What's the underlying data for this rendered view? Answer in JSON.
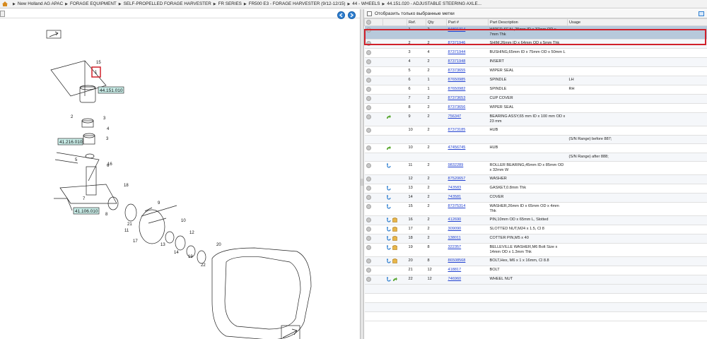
{
  "breadcrumb": [
    "New Holland AG APAC",
    "FORAGE EQUIPMENT",
    "SELF-PROPELLED FORAGE HARVESTER",
    "FR SERIES",
    "FR500 E3 - FORAGE HARVESTER (9/12-12/15)",
    "44 - WHEELS",
    "44.151.020 - ADJUSTABLE STEERING AXLE..."
  ],
  "filter_label": "Отобразить только выбранные метки",
  "columns": {
    "ref": "Ref.",
    "qty": "Qty",
    "part": "Part #",
    "desc": "Part Description",
    "usage": "Usage"
  },
  "rows": [
    {
      "ref": "1",
      "qty": "2",
      "part": "84801314",
      "desc": "WIPER SEAL,25mm ID x 37mm OD x 7mm Thk",
      "usage": "",
      "icons": []
    },
    {
      "ref": "2",
      "qty": "2",
      "part": "87371946",
      "desc": "SHIM,26mm ID x 64mm OD x 5mm Thk",
      "usage": "",
      "icons": []
    },
    {
      "ref": "3",
      "qty": "4",
      "part": "87371944",
      "desc": "BUSHING,65mm ID x 75mm OD x 50mm L",
      "usage": "",
      "icons": []
    },
    {
      "ref": "4",
      "qty": "2",
      "part": "87371948",
      "desc": "INSERT",
      "usage": "",
      "icons": []
    },
    {
      "ref": "5",
      "qty": "2",
      "part": "87373655",
      "desc": "WIPER SEAL",
      "usage": "",
      "icons": []
    },
    {
      "ref": "6",
      "qty": "1",
      "part": "87650985",
      "desc": "SPINDLE",
      "usage": "LH",
      "icons": []
    },
    {
      "ref": "6",
      "qty": "1",
      "part": "87650982",
      "desc": "SPINDLE",
      "usage": "RH",
      "icons": []
    },
    {
      "ref": "7",
      "qty": "2",
      "part": "87373653",
      "desc": "CUP COVER",
      "usage": "",
      "icons": []
    },
    {
      "ref": "8",
      "qty": "2",
      "part": "87373656",
      "desc": "WIPER SEAL",
      "usage": "",
      "icons": []
    },
    {
      "ref": "9",
      "qty": "2",
      "part": "756347",
      "desc": "BEARING ASSY,65 mm ID x 100 mm OD x 23 mm",
      "usage": "",
      "icons": [
        "green"
      ]
    },
    {
      "ref": "10",
      "qty": "2",
      "part": "87373185",
      "desc": "HUB",
      "usage": "",
      "icons": []
    },
    {
      "ref": "",
      "qty": "",
      "part": "",
      "desc": "",
      "usage": "(S/N Range) before 887;",
      "icons": []
    },
    {
      "ref": "10",
      "qty": "2",
      "part": "47456745",
      "desc": "HUB",
      "usage": "",
      "icons": [
        "green"
      ]
    },
    {
      "ref": "",
      "qty": "",
      "part": "",
      "desc": "",
      "usage": "(S/N Range) after 888;",
      "icons": []
    },
    {
      "ref": "11",
      "qty": "2",
      "part": "9832289",
      "desc": "ROLLER BEARING,45mm ID x 85mm OD x 32mm W",
      "usage": "",
      "icons": [
        "blue"
      ]
    },
    {
      "ref": "12",
      "qty": "2",
      "part": "87520657",
      "desc": "WASHER",
      "usage": "",
      "icons": []
    },
    {
      "ref": "13",
      "qty": "2",
      "part": "743583",
      "desc": "GASKET,0.8mm Thk",
      "usage": "",
      "icons": [
        "blue"
      ]
    },
    {
      "ref": "14",
      "qty": "2",
      "part": "743581",
      "desc": "COVER",
      "usage": "",
      "icons": [
        "blue"
      ]
    },
    {
      "ref": "15",
      "qty": "2",
      "part": "87375314",
      "desc": "WASHER,26mm ID x 65mm OD x 4mm Thk",
      "usage": "",
      "icons": [
        "blue"
      ]
    },
    {
      "ref": "16",
      "qty": "2",
      "part": "412690",
      "desc": "PIN,10mm OD x 65mm L, Slotted",
      "usage": "",
      "icons": [
        "blue",
        "box"
      ]
    },
    {
      "ref": "17",
      "qty": "2",
      "part": "309090",
      "desc": "SLOTTED NUT,M24 x 1.5, Cl 8",
      "usage": "",
      "icons": [
        "blue",
        "box"
      ]
    },
    {
      "ref": "18",
      "qty": "2",
      "part": "138011",
      "desc": "COTTER PIN,M5 x 40",
      "usage": "",
      "icons": [
        "blue",
        "box"
      ]
    },
    {
      "ref": "19",
      "qty": "8",
      "part": "322357",
      "desc": "BELLEVILLE WASHER,M6 Bolt Size x 14mm OD x 1.3mm Thk",
      "usage": "",
      "icons": [
        "blue",
        "box"
      ]
    },
    {
      "ref": "20",
      "qty": "8",
      "part": "86508568",
      "desc": "BOLT,Hex, M6 x 1 x 16mm, Cl 8.8",
      "usage": "",
      "icons": [
        "blue",
        "box"
      ]
    },
    {
      "ref": "21",
      "qty": "12",
      "part": "418817",
      "desc": "BOLT",
      "usage": "",
      "icons": []
    },
    {
      "ref": "22",
      "qty": "12",
      "part": "746960",
      "desc": "WHEEL NUT",
      "usage": "",
      "icons": [
        "blue",
        "green"
      ]
    }
  ],
  "diagram_labels": [
    "44.151.010",
    "41.216.010",
    "41.106.010"
  ],
  "callouts": [
    "15",
    "1",
    "2",
    "3",
    "4",
    "3",
    "5",
    "16",
    "6",
    "18",
    "7",
    "8",
    "21",
    "9",
    "11",
    "10",
    "17",
    "12",
    "13",
    "14",
    "19",
    "20",
    "22"
  ]
}
